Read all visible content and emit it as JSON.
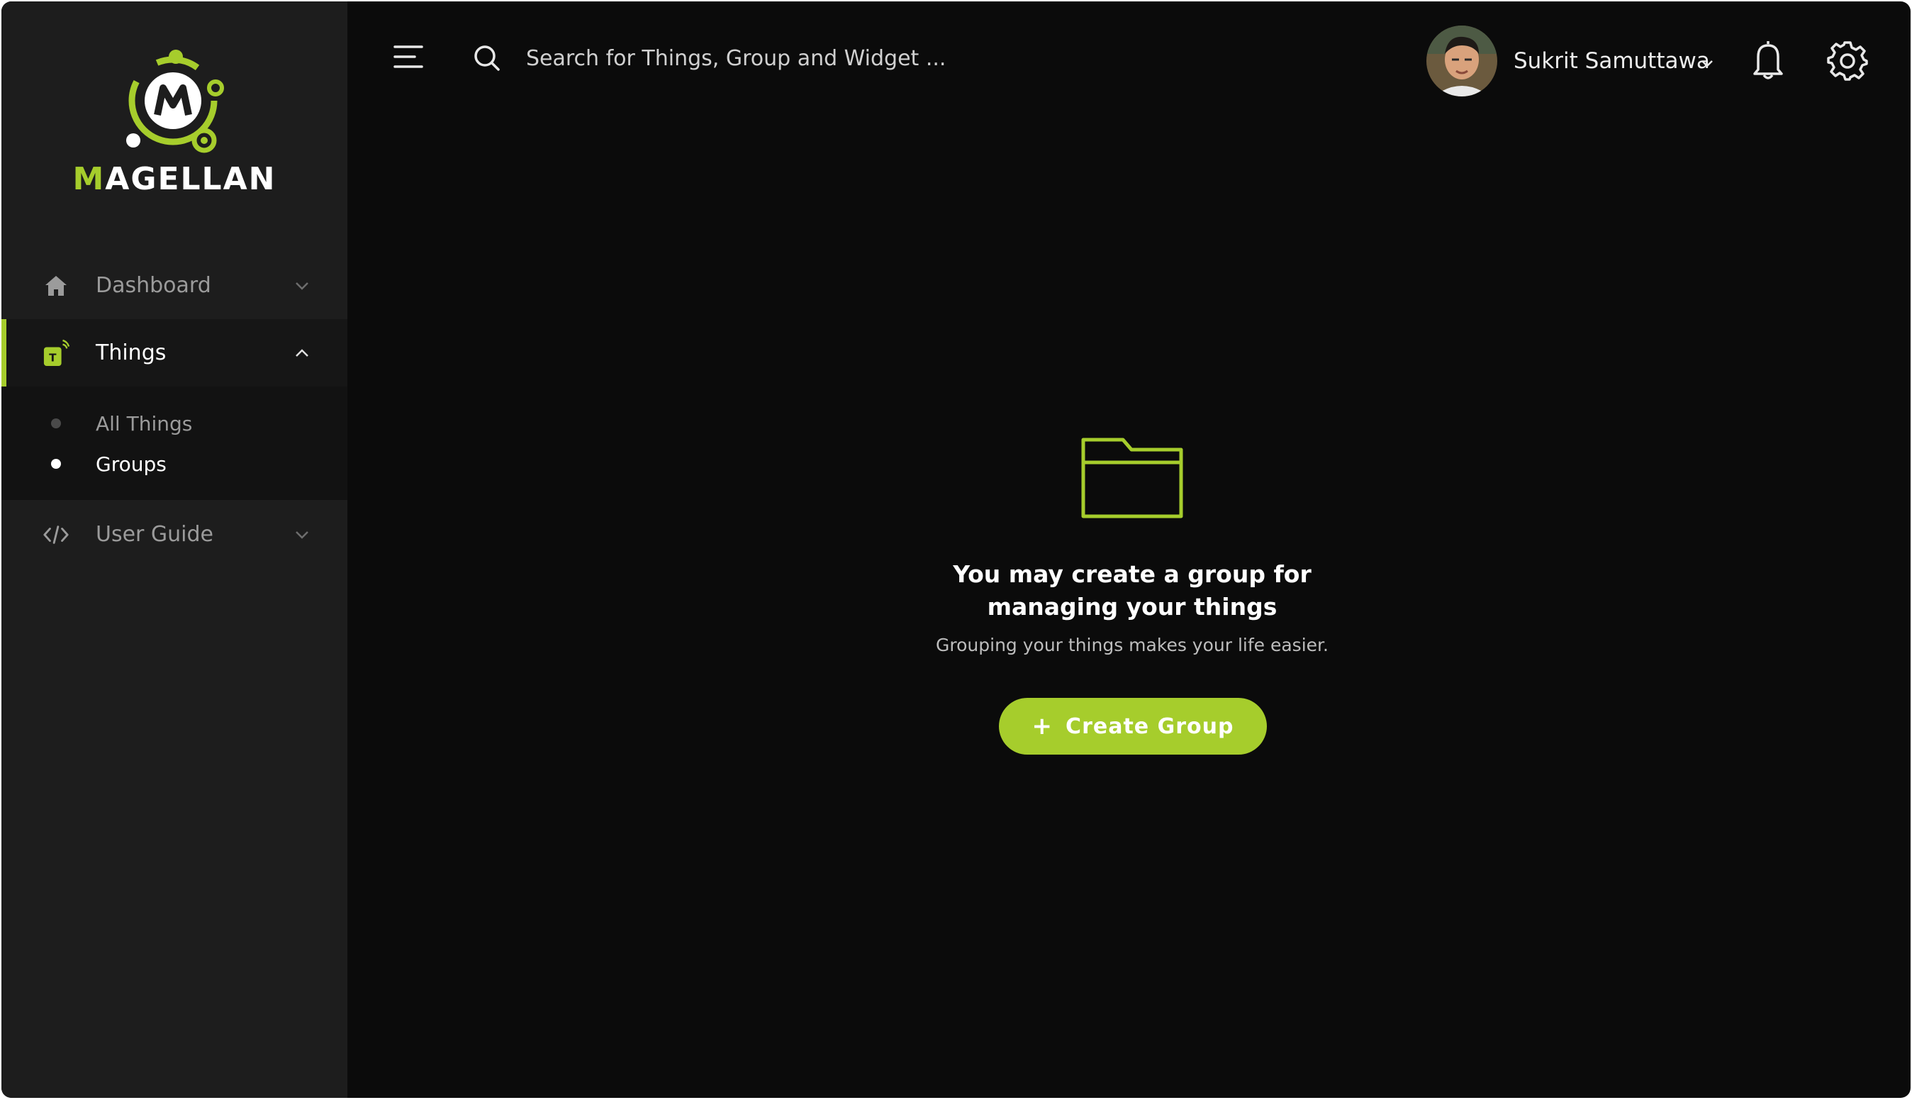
{
  "brand": {
    "name_first_letter": "M",
    "name_rest": "AGELLAN",
    "accent_color": "#a6cd2c"
  },
  "sidebar": {
    "items": [
      {
        "label": "Dashboard",
        "icon": "home-icon",
        "expanded": false
      },
      {
        "label": "Things",
        "icon": "things-icon",
        "expanded": true
      },
      {
        "label": "User Guide",
        "icon": "code-icon",
        "expanded": false
      }
    ],
    "things_subitems": [
      {
        "label": "All Things",
        "active": false
      },
      {
        "label": "Groups",
        "active": true
      }
    ]
  },
  "header": {
    "search_placeholder": "Search for Things, Group and Widget ...",
    "user_name": "Sukrit Samuttawa"
  },
  "empty_state": {
    "title": "You may create a group for\nmanaging your things",
    "subtitle": "Grouping your things makes your life easier.",
    "button_plus": "+",
    "button_label": "Create Group"
  }
}
